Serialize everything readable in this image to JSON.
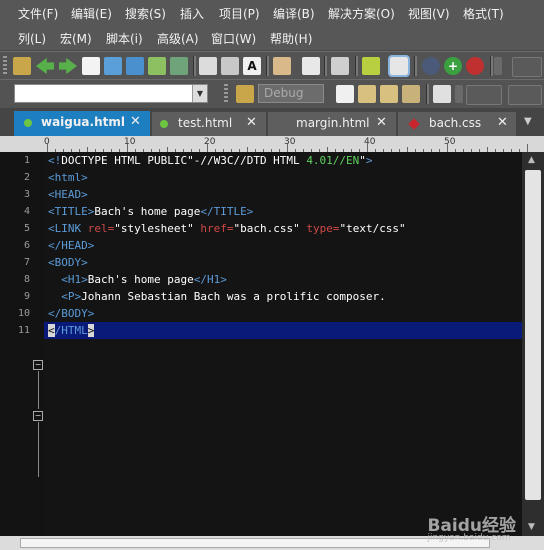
{
  "menu_row1": [
    "文件(F)",
    "编辑(E)",
    "搜索(S)",
    "插入",
    "项目(P)",
    "编译(B)",
    "解决方案(O)",
    "视图(V)",
    "格式(T)"
  ],
  "menu_row2": [
    "列(L)",
    "宏(M)",
    "脚本(i)",
    "高级(A)",
    "窗口(W)",
    "帮助(H)"
  ],
  "toolbar": {
    "search_value": "",
    "config_value": "Debug",
    "icons_row1": [
      "new-icon",
      "back-icon",
      "forward-icon",
      "page-icon",
      "open-folder-icon",
      "folder-icon",
      "image-icon",
      "tools-icon",
      "print-icon",
      "print-preview-icon",
      "font-icon",
      "list-icon",
      "document-icon",
      "ruler-icon",
      "columns-icon",
      "notes-icon",
      "browser-icon",
      "add-icon",
      "stop-icon"
    ]
  },
  "tabs": [
    {
      "label": "waigua.html",
      "active": true,
      "dot": "#6cc644"
    },
    {
      "label": "test.html",
      "active": false,
      "dot": "#6cc644"
    },
    {
      "label": "margin.html",
      "active": false,
      "dot": ""
    },
    {
      "label": "bach.css",
      "active": false,
      "dot": "#c8262c"
    }
  ],
  "ruler": {
    "labels": [
      "0",
      "10",
      "20",
      "30",
      "40",
      "50"
    ]
  },
  "editor": {
    "line_numbers": [
      "1",
      "2",
      "3",
      "4",
      "5",
      "6",
      "7",
      "8",
      "9",
      "10",
      "11"
    ],
    "current_line": 11,
    "lines": [
      [
        [
          "t",
          "<!"
        ],
        [
          "s",
          "DOCTYPE HTML PUBLIC"
        ],
        [
          "s",
          "\"-//W3C//DTD HTML "
        ],
        [
          "g",
          "4.01//EN"
        ],
        [
          "s",
          "\""
        ],
        [
          "t",
          ">"
        ]
      ],
      [
        [
          "t",
          "<html>"
        ]
      ],
      [
        [
          "t",
          "<HEAD>"
        ]
      ],
      [
        [
          "t",
          "<TITLE>"
        ],
        [
          "s",
          "Bach's home page"
        ],
        [
          "t",
          "</TITLE>"
        ]
      ],
      [
        [
          "t",
          "<LINK "
        ],
        [
          "a",
          "rel="
        ],
        [
          "s",
          "\"stylesheet\" "
        ],
        [
          "a",
          "href="
        ],
        [
          "s",
          "\"bach.css\" "
        ],
        [
          "a",
          "type="
        ],
        [
          "s",
          "\"text/css\""
        ]
      ],
      [
        [
          "t",
          "</HEAD>"
        ]
      ],
      [
        [
          "t",
          "<BODY>"
        ]
      ],
      [
        [
          "s",
          "  "
        ],
        [
          "t",
          "<H1>"
        ],
        [
          "s",
          "Bach's home page"
        ],
        [
          "t",
          "</H1>"
        ]
      ],
      [
        [
          "s",
          "  "
        ],
        [
          "t",
          "<P>"
        ],
        [
          "s",
          "Johann Sebastian Bach was a prolific composer."
        ]
      ],
      [
        [
          "t",
          "</BODY>"
        ]
      ],
      [
        [
          "caret",
          "<"
        ],
        [
          "t",
          "/HTML"
        ],
        [
          "caret",
          ">"
        ]
      ]
    ]
  },
  "colors": {
    "tag": "#5b9bd8",
    "attr": "#d04848",
    "string": "#ffffff",
    "version": "#5ed05e",
    "active_tab": "#1e7fc0",
    "current_line": "#0a1a78"
  },
  "watermark": {
    "text": "Baidu经验",
    "url": "jingyan.baidu.com"
  }
}
